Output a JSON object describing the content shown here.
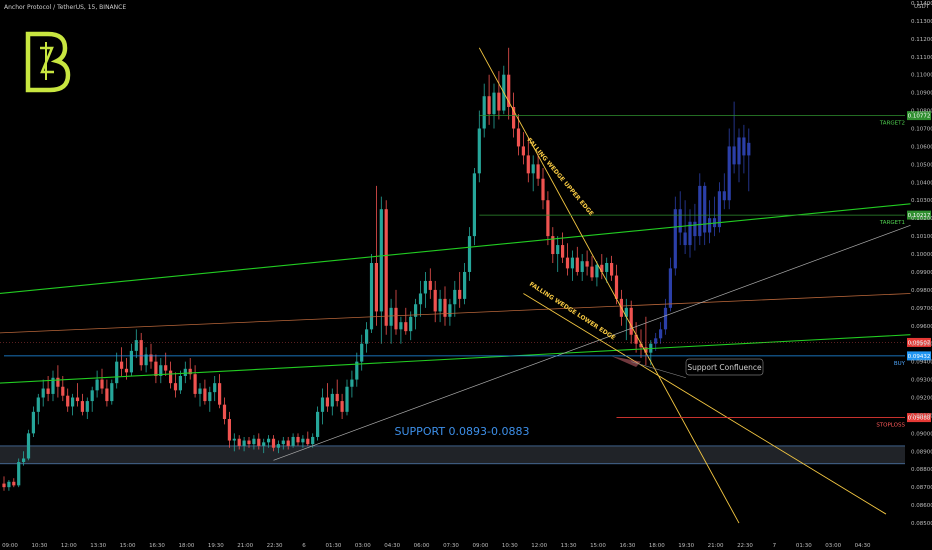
{
  "header": {
    "symbol_line": "Anchor Protocol / TetherUS, 15, BINANCE"
  },
  "colors": {
    "up": "#26a69a",
    "down": "#ef5350",
    "projection": "#2b3fa8",
    "support_zone": "#3a3f48",
    "wedge": "#f5c842",
    "trend_green": "#22cc22",
    "trend_orange": "#b8663a",
    "grey_line": "#aaaaaa",
    "target_line": "#2f8f2f",
    "buy_line": "#2196f3",
    "stop_line": "#e53935",
    "logo": "#c8e640"
  },
  "logo": {
    "letter": "B"
  },
  "chart_data": {
    "type": "candlestick",
    "quote_currency": "USDT",
    "ylim": [
      0.0845,
      0.1145
    ],
    "y_ticks": [
      0.114,
      0.113,
      0.112,
      0.111,
      0.11,
      0.109,
      0.108,
      0.107,
      0.106,
      0.105,
      0.104,
      0.103,
      0.102,
      0.101,
      0.1,
      0.099,
      0.098,
      0.097,
      0.096,
      0.095,
      0.094,
      0.093,
      0.092,
      0.091,
      0.09,
      0.089,
      0.088,
      0.087,
      0.086,
      0.085
    ],
    "y_tick_labels": [
      "0.11400",
      "0.11300",
      "0.11200",
      "0.11100",
      "0.11000",
      "0.10900",
      "0.10800",
      "0.10700",
      "0.10600",
      "0.10500",
      "0.10400",
      "0.10300",
      "0.10200",
      "0.10100",
      "0.10000",
      "0.09900",
      "0.09800",
      "0.09700",
      "0.09600",
      "0.09500",
      "0.09400",
      "0.09300",
      "0.09200",
      "0.09100",
      "0.09000",
      "0.08900",
      "0.08800",
      "0.08700",
      "0.08600",
      "0.08500"
    ],
    "x_tick_labels": [
      "09:00",
      "10:30",
      "12:00",
      "13:30",
      "15:00",
      "16:30",
      "18:00",
      "19:30",
      "21:00",
      "22:30",
      "6",
      "01:30",
      "03:00",
      "04:30",
      "06:00",
      "07:30",
      "09:00",
      "10:30",
      "12:00",
      "13:30",
      "15:00",
      "16:30",
      "18:00",
      "19:30",
      "21:00",
      "22:30",
      "7",
      "01:30",
      "03:00",
      "04:30"
    ],
    "x_tick_index": [
      0,
      6,
      12,
      18,
      24,
      30,
      36,
      42,
      48,
      54,
      60,
      66,
      72,
      78,
      84,
      90,
      96,
      102,
      108,
      114,
      120,
      126,
      132,
      138,
      144,
      150,
      156,
      162,
      168,
      174
    ],
    "candles": [
      [
        0.0872,
        0.0876,
        0.0868,
        0.087
      ],
      [
        0.087,
        0.0874,
        0.0868,
        0.0873
      ],
      [
        0.0873,
        0.0875,
        0.087,
        0.0871
      ],
      [
        0.0871,
        0.0886,
        0.087,
        0.0884
      ],
      [
        0.0884,
        0.089,
        0.0882,
        0.0886
      ],
      [
        0.0886,
        0.0902,
        0.0885,
        0.09
      ],
      [
        0.09,
        0.0915,
        0.0898,
        0.0912
      ],
      [
        0.0912,
        0.0922,
        0.0905,
        0.092
      ],
      [
        0.092,
        0.093,
        0.0915,
        0.0925
      ],
      [
        0.0925,
        0.0932,
        0.0918,
        0.0922
      ],
      [
        0.0922,
        0.0935,
        0.0918,
        0.0931
      ],
      [
        0.0931,
        0.0938,
        0.092,
        0.0926
      ],
      [
        0.0926,
        0.0932,
        0.0918,
        0.0921
      ],
      [
        0.0921,
        0.0925,
        0.0912,
        0.0915
      ],
      [
        0.0915,
        0.0922,
        0.091,
        0.092
      ],
      [
        0.092,
        0.0928,
        0.0915,
        0.0918
      ],
      [
        0.0918,
        0.0922,
        0.091,
        0.0912
      ],
      [
        0.0912,
        0.092,
        0.0908,
        0.0918
      ],
      [
        0.0918,
        0.0926,
        0.0912,
        0.0924
      ],
      [
        0.0924,
        0.0935,
        0.092,
        0.093
      ],
      [
        0.093,
        0.0936,
        0.0922,
        0.0925
      ],
      [
        0.0925,
        0.093,
        0.0915,
        0.0918
      ],
      [
        0.0918,
        0.093,
        0.0916,
        0.0928
      ],
      [
        0.0928,
        0.0945,
        0.0925,
        0.094
      ],
      [
        0.094,
        0.0948,
        0.0932,
        0.0936
      ],
      [
        0.0936,
        0.0942,
        0.093,
        0.0934
      ],
      [
        0.0934,
        0.095,
        0.0932,
        0.0946
      ],
      [
        0.0946,
        0.0958,
        0.0942,
        0.0952
      ],
      [
        0.0952,
        0.0956,
        0.0935,
        0.0938
      ],
      [
        0.0938,
        0.0948,
        0.0934,
        0.0944
      ],
      [
        0.0944,
        0.095,
        0.0936,
        0.094
      ],
      [
        0.094,
        0.0944,
        0.0928,
        0.0932
      ],
      [
        0.0932,
        0.0942,
        0.0928,
        0.0938
      ],
      [
        0.0938,
        0.0945,
        0.0932,
        0.0935
      ],
      [
        0.0935,
        0.094,
        0.0925,
        0.0928
      ],
      [
        0.0928,
        0.0934,
        0.092,
        0.0924
      ],
      [
        0.0924,
        0.0935,
        0.0922,
        0.0932
      ],
      [
        0.0932,
        0.094,
        0.0928,
        0.0936
      ],
      [
        0.0936,
        0.0942,
        0.093,
        0.0933
      ],
      [
        0.0933,
        0.0938,
        0.092,
        0.0922
      ],
      [
        0.0922,
        0.0928,
        0.0915,
        0.0925
      ],
      [
        0.0925,
        0.093,
        0.0916,
        0.0918
      ],
      [
        0.0918,
        0.0926,
        0.0912,
        0.0923
      ],
      [
        0.0923,
        0.0932,
        0.0918,
        0.0928
      ],
      [
        0.0928,
        0.0933,
        0.0914,
        0.0916
      ],
      [
        0.0916,
        0.092,
        0.0905,
        0.0908
      ],
      [
        0.0908,
        0.0912,
        0.0892,
        0.0896
      ],
      [
        0.0896,
        0.09,
        0.089,
        0.0897
      ],
      [
        0.0897,
        0.0899,
        0.0891,
        0.0893
      ],
      [
        0.0893,
        0.0898,
        0.089,
        0.0896
      ],
      [
        0.0896,
        0.0898,
        0.0892,
        0.0894
      ],
      [
        0.0894,
        0.0899,
        0.0891,
        0.0897
      ],
      [
        0.0897,
        0.09,
        0.0891,
        0.0893
      ],
      [
        0.0893,
        0.0897,
        0.0889,
        0.0895
      ],
      [
        0.0895,
        0.0899,
        0.0892,
        0.0897
      ],
      [
        0.0897,
        0.0899,
        0.089,
        0.0892
      ],
      [
        0.0892,
        0.0896,
        0.0889,
        0.0894
      ],
      [
        0.0894,
        0.0898,
        0.0891,
        0.0896
      ],
      [
        0.0896,
        0.0898,
        0.0891,
        0.0893
      ],
      [
        0.0893,
        0.09,
        0.0892,
        0.0898
      ],
      [
        0.0898,
        0.09,
        0.0893,
        0.0895
      ],
      [
        0.0895,
        0.0899,
        0.0892,
        0.0897
      ],
      [
        0.0897,
        0.0901,
        0.0893,
        0.0894
      ],
      [
        0.0894,
        0.09,
        0.0892,
        0.0898
      ],
      [
        0.0898,
        0.0915,
        0.0896,
        0.0912
      ],
      [
        0.0912,
        0.0925,
        0.0905,
        0.092
      ],
      [
        0.092,
        0.0928,
        0.0912,
        0.0915
      ],
      [
        0.0915,
        0.0925,
        0.091,
        0.0922
      ],
      [
        0.0922,
        0.093,
        0.0915,
        0.0918
      ],
      [
        0.0918,
        0.0922,
        0.0908,
        0.0912
      ],
      [
        0.0912,
        0.093,
        0.091,
        0.0926
      ],
      [
        0.0926,
        0.0935,
        0.092,
        0.093
      ],
      [
        0.093,
        0.0945,
        0.0926,
        0.094
      ],
      [
        0.094,
        0.0955,
        0.0935,
        0.095
      ],
      [
        0.095,
        0.0962,
        0.0945,
        0.0958
      ],
      [
        0.0958,
        0.1,
        0.0956,
        0.0995
      ],
      [
        0.0995,
        0.1038,
        0.096,
        0.0968
      ],
      [
        0.0968,
        0.1032,
        0.095,
        0.1025
      ],
      [
        0.1025,
        0.103,
        0.0955,
        0.096
      ],
      [
        0.096,
        0.0975,
        0.095,
        0.097
      ],
      [
        0.097,
        0.098,
        0.0955,
        0.0958
      ],
      [
        0.0958,
        0.0965,
        0.095,
        0.0962
      ],
      [
        0.0962,
        0.097,
        0.0955,
        0.0957
      ],
      [
        0.0957,
        0.0968,
        0.0952,
        0.0965
      ],
      [
        0.0965,
        0.0975,
        0.0958,
        0.0972
      ],
      [
        0.0972,
        0.0985,
        0.0965,
        0.0978
      ],
      [
        0.0978,
        0.099,
        0.097,
        0.0985
      ],
      [
        0.0985,
        0.0992,
        0.0975,
        0.098
      ],
      [
        0.098,
        0.0985,
        0.0962,
        0.0968
      ],
      [
        0.0968,
        0.098,
        0.0962,
        0.0975
      ],
      [
        0.0975,
        0.0982,
        0.096,
        0.0965
      ],
      [
        0.0965,
        0.0975,
        0.096,
        0.0972
      ],
      [
        0.0972,
        0.0985,
        0.0965,
        0.098
      ],
      [
        0.098,
        0.099,
        0.097,
        0.0975
      ],
      [
        0.0975,
        0.0995,
        0.0972,
        0.099
      ],
      [
        0.099,
        0.1015,
        0.0985,
        0.101
      ],
      [
        0.101,
        0.1048,
        0.1005,
        0.1045
      ],
      [
        0.1045,
        0.108,
        0.104,
        0.107
      ],
      [
        0.107,
        0.1095,
        0.1065,
        0.1088
      ],
      [
        0.1088,
        0.11,
        0.1072,
        0.1078
      ],
      [
        0.1078,
        0.1095,
        0.107,
        0.109
      ],
      [
        0.109,
        0.1102,
        0.1075,
        0.108
      ],
      [
        0.108,
        0.1105,
        0.1078,
        0.11
      ],
      [
        0.11,
        0.1115,
        0.1075,
        0.1082
      ],
      [
        0.1082,
        0.109,
        0.1065,
        0.107
      ],
      [
        0.107,
        0.1078,
        0.1055,
        0.106
      ],
      [
        0.106,
        0.1068,
        0.105,
        0.1055
      ],
      [
        0.1055,
        0.1065,
        0.104,
        0.1045
      ],
      [
        0.1045,
        0.1055,
        0.1035,
        0.105
      ],
      [
        0.105,
        0.1056,
        0.1038,
        0.1042
      ],
      [
        0.1042,
        0.1048,
        0.1025,
        0.103
      ],
      [
        0.103,
        0.1035,
        0.1005,
        0.101
      ],
      [
        0.101,
        0.1015,
        0.0995,
        0.1
      ],
      [
        0.1,
        0.101,
        0.099,
        0.1005
      ],
      [
        0.1005,
        0.1012,
        0.0995,
        0.0998
      ],
      [
        0.0998,
        0.1006,
        0.0988,
        0.0992
      ],
      [
        0.0992,
        0.1002,
        0.0985,
        0.0998
      ],
      [
        0.0998,
        0.1004,
        0.0988,
        0.099
      ],
      [
        0.099,
        0.1,
        0.0985,
        0.0996
      ],
      [
        0.0996,
        0.1002,
        0.0988,
        0.0993
      ],
      [
        0.0993,
        0.0999,
        0.0985,
        0.0987
      ],
      [
        0.0987,
        0.0996,
        0.0982,
        0.0994
      ],
      [
        0.0994,
        0.1,
        0.0986,
        0.099
      ],
      [
        0.099,
        0.0998,
        0.0984,
        0.0995
      ],
      [
        0.0995,
        0.0999,
        0.0985,
        0.0988
      ],
      [
        0.0988,
        0.0994,
        0.0972,
        0.0975
      ],
      [
        0.0975,
        0.098,
        0.096,
        0.0965
      ],
      [
        0.0965,
        0.0975,
        0.0952,
        0.097
      ],
      [
        0.097,
        0.0974,
        0.095,
        0.0955
      ],
      [
        0.0955,
        0.0962,
        0.0945,
        0.095
      ],
      [
        0.095,
        0.0958,
        0.0942,
        0.0948
      ],
      [
        0.0948,
        0.0965,
        0.0938,
        0.0945
      ],
      [
        0.0945,
        0.0952,
        0.0938,
        0.095
      ]
    ],
    "projection": [
      [
        0.095,
        0.0956,
        0.0946,
        0.0953
      ],
      [
        0.0953,
        0.0962,
        0.095,
        0.0958
      ],
      [
        0.0958,
        0.0975,
        0.0955,
        0.097
      ],
      [
        0.097,
        0.0998,
        0.0968,
        0.0992
      ],
      [
        0.0992,
        0.1032,
        0.0988,
        0.1025
      ],
      [
        0.1025,
        0.1035,
        0.1005,
        0.1012
      ],
      [
        0.1012,
        0.103,
        0.1,
        0.1005
      ],
      [
        0.1005,
        0.1025,
        0.0998,
        0.1018
      ],
      [
        0.1018,
        0.1028,
        0.1002,
        0.101
      ],
      [
        0.101,
        0.1045,
        0.1005,
        0.1038
      ],
      [
        0.1038,
        0.104,
        0.1005,
        0.1012
      ],
      [
        0.1012,
        0.103,
        0.1006,
        0.102
      ],
      [
        0.102,
        0.1032,
        0.101,
        0.1015
      ],
      [
        0.1015,
        0.104,
        0.1012,
        0.1035
      ],
      [
        0.1035,
        0.1045,
        0.1025,
        0.103
      ],
      [
        0.103,
        0.107,
        0.1025,
        0.106
      ],
      [
        0.106,
        0.1085,
        0.1045,
        0.105
      ],
      [
        0.105,
        0.107,
        0.104,
        0.1065
      ],
      [
        0.1065,
        0.1072,
        0.1045,
        0.1055
      ],
      [
        0.1055,
        0.107,
        0.1035,
        0.1062
      ]
    ],
    "levels": [
      {
        "name": "TARGET2",
        "value": 0.10772,
        "label": "TARGET2",
        "price_tag": "0.10772"
      },
      {
        "name": "TARGET1",
        "value": 0.10217,
        "label": "TARGET1",
        "price_tag": "0.10217"
      },
      {
        "name": "BUY",
        "value": 0.09432,
        "label": "BUY",
        "price_tag": "0.09432"
      },
      {
        "name": "STOPLOSS",
        "value": 0.09088,
        "label": "STOPLOSS",
        "price_tag": "0.09088"
      }
    ],
    "current_price": {
      "value": 0.09507,
      "tag": "0.09507"
    },
    "support_zone": {
      "low": 0.0883,
      "high": 0.0893,
      "label": "SUPPORT 0.0893-0.0883"
    },
    "annotations": {
      "upper_edge": "FALLING WEDGE UPPER EDGE",
      "lower_edge": "FALLING WEDGE LOWER EDGE",
      "confluence": "Support Confluence"
    }
  }
}
